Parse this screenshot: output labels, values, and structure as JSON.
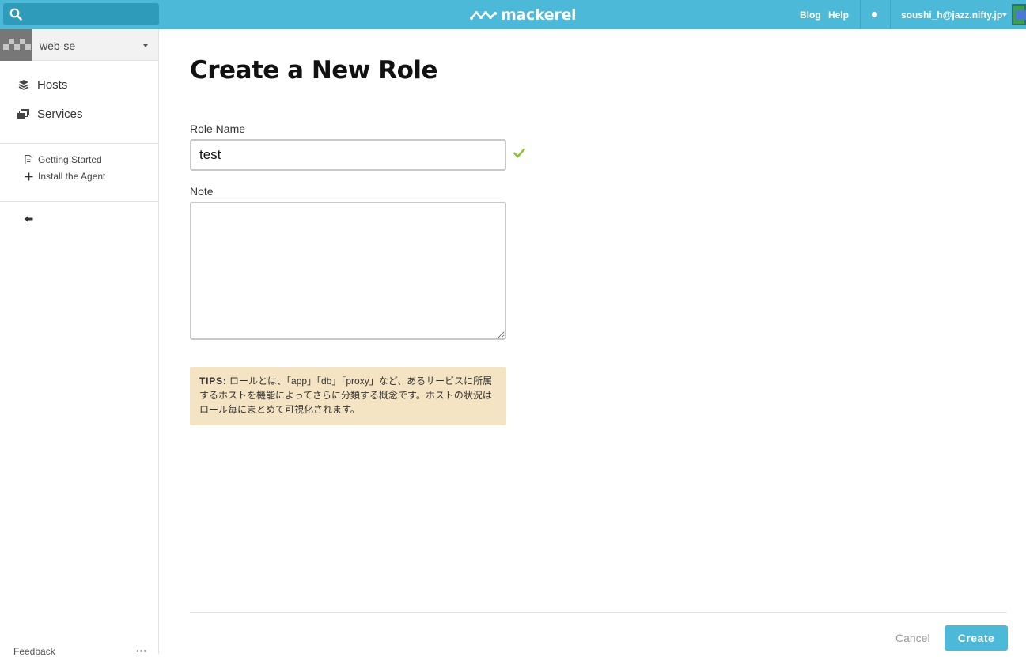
{
  "topbar": {
    "search_placeholder": "",
    "logo_text": "mackerel",
    "links": {
      "blog": "Blog",
      "help": "Help"
    },
    "user": "soushi_h@jazz.nifty.jp"
  },
  "sidebar": {
    "org_name": "web-se",
    "nav": [
      {
        "label": "Hosts",
        "icon": "layers-icon"
      },
      {
        "label": "Services",
        "icon": "services-icon"
      }
    ],
    "sub": [
      {
        "label": "Getting Started",
        "icon": "document-icon"
      },
      {
        "label": "Install the Agent",
        "icon": "plus-icon"
      }
    ],
    "feedback": "Feedback",
    "more": "···"
  },
  "main": {
    "title": "Create a New Role",
    "role_name_label": "Role Name",
    "role_name_value": "test",
    "note_label": "Note",
    "note_value": "",
    "tips_prefix": "TIPS:",
    "tips_text": "ロールとは、「app」「db」「proxy」など、あるサービスに所属するホストを機能によってさらに分類する概念です。ホストの状況はロール毎にまとめて可視化されます。",
    "cancel_label": "Cancel",
    "create_label": "Create"
  },
  "colors": {
    "accent": "#4cb9d9",
    "tips_bg": "#f5e4c3",
    "valid": "#8cc63f"
  }
}
